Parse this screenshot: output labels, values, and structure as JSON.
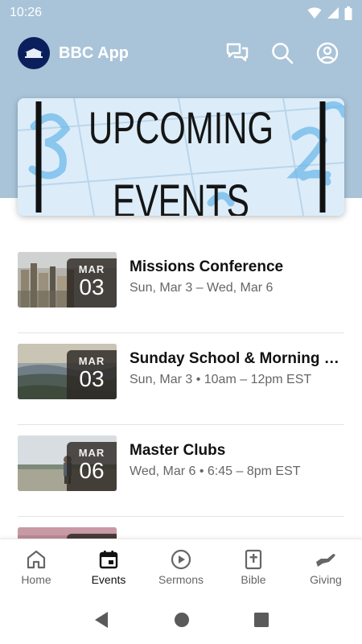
{
  "status_bar": {
    "time": "10:26"
  },
  "header": {
    "app_title": "BBC App"
  },
  "banner": {
    "line1": "UPCOMING",
    "line2": "EVENTS"
  },
  "events": [
    {
      "month": "MAR",
      "day": "03",
      "title": "Missions Conference",
      "subtitle": "Sun, Mar 3 – Wed, Mar 6"
    },
    {
      "month": "MAR",
      "day": "03",
      "title": "Sunday School & Morning Worship",
      "subtitle": "Sun, Mar 3 • 10am – 12pm EST"
    },
    {
      "month": "MAR",
      "day": "06",
      "title": "Master Clubs",
      "subtitle": "Wed, Mar 6 • 6:45 – 8pm EST"
    }
  ],
  "bottom_nav": {
    "active": "Events",
    "items": [
      {
        "label": "Home",
        "icon": "home-icon"
      },
      {
        "label": "Events",
        "icon": "calendar-icon"
      },
      {
        "label": "Sermons",
        "icon": "play-circle-icon"
      },
      {
        "label": "Bible",
        "icon": "bible-icon"
      },
      {
        "label": "Giving",
        "icon": "giving-hand-icon"
      }
    ]
  },
  "colors": {
    "header_bg": "#a9c4d9",
    "logo_bg": "#0b1f5c",
    "text_primary": "#111111",
    "text_secondary": "#666666"
  }
}
